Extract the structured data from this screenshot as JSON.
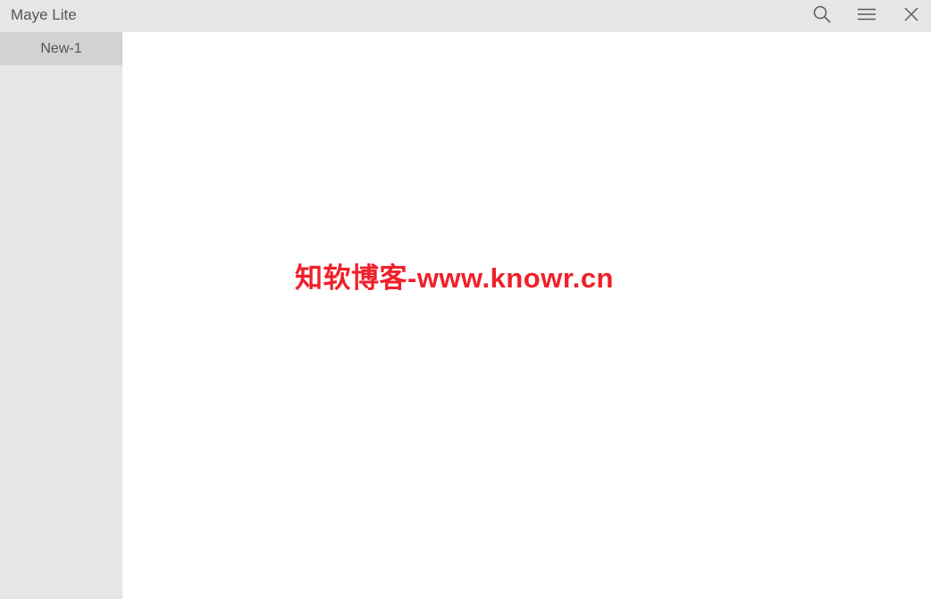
{
  "window": {
    "title": "Maye Lite"
  },
  "toolbar": {
    "search_icon": "search-icon",
    "menu_icon": "hamburger-menu-icon",
    "close_icon": "close-icon",
    "icon_color": "#5a5a5a"
  },
  "tabs": [
    {
      "label": "New-1",
      "active": true
    }
  ],
  "editor": {
    "content": ""
  },
  "watermark": {
    "text": "知软博客-www.knowr.cn",
    "color": "#f0202a"
  },
  "colors": {
    "titlebar_bg": "#e6e6e6",
    "sidebar_bg": "#e6e6e6",
    "active_tab_bg": "#d2d2d2",
    "editor_bg": "#ffffff"
  }
}
